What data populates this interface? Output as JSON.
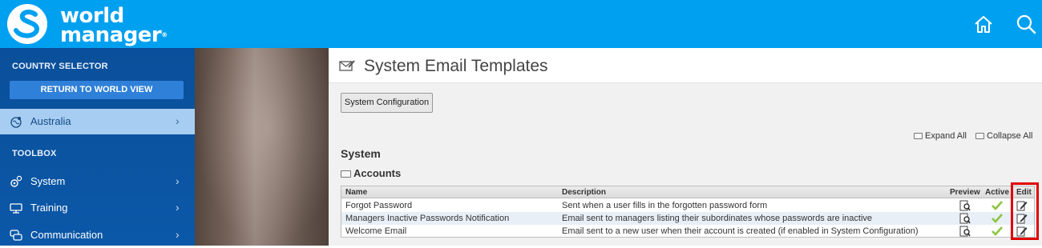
{
  "header": {
    "logo_line1": "world",
    "logo_line2": "manager",
    "logo_mark": "®",
    "icons": [
      "home-icon",
      "search-icon"
    ]
  },
  "sidebar": {
    "country_selector_label": "COUNTRY SELECTOR",
    "return_button": "RETURN TO WORLD VIEW",
    "country": {
      "label": "Australia",
      "icon": "globe-pin-icon"
    },
    "toolbox_label": "TOOLBOX",
    "items": [
      {
        "label": "System",
        "icon": "gears-icon"
      },
      {
        "label": "Training",
        "icon": "training-icon"
      },
      {
        "label": "Communication",
        "icon": "chat-icon"
      }
    ]
  },
  "main": {
    "title": "System Email Templates",
    "system_config_button": "System Configuration",
    "expand_all": "Expand All",
    "collapse_all": "Collapse All",
    "section": "System",
    "group": "Accounts",
    "table": {
      "headers": {
        "name": "Name",
        "description": "Description",
        "preview": "Preview",
        "active": "Active",
        "edit": "Edit"
      },
      "rows": [
        {
          "name": "Forgot Password",
          "description": "Sent when a user fills in the forgotten password form",
          "active": true
        },
        {
          "name": "Managers Inactive Passwords Notification",
          "description": "Email sent to managers listing their subordinates whose passwords are inactive",
          "active": true
        },
        {
          "name": "Welcome Email",
          "description": "Email sent to a new user when their account is created (if enabled in System Configuration)",
          "active": true
        }
      ]
    }
  },
  "colors": {
    "brand_blue": "#00a0f0",
    "sidebar_blue": "#0b58a8",
    "highlight_red": "#e00000",
    "active_green": "#8bc53f"
  }
}
